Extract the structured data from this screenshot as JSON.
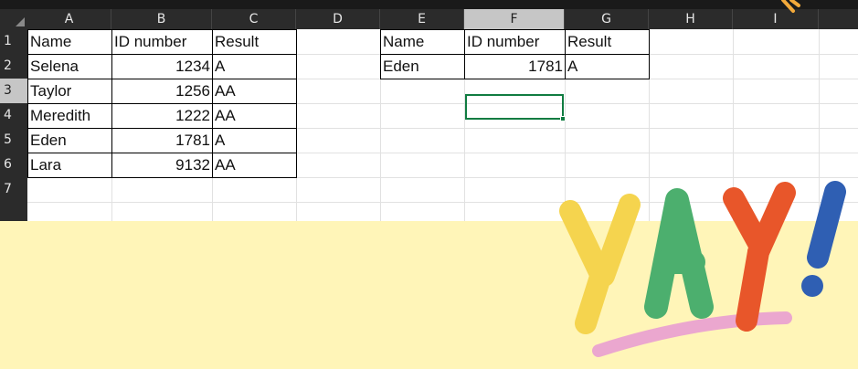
{
  "spreadsheet": {
    "columns": [
      "A",
      "B",
      "C",
      "D",
      "E",
      "F",
      "G",
      "H",
      "I"
    ],
    "active_column": "F",
    "rows": [
      "1",
      "2",
      "3",
      "4",
      "5",
      "6",
      "7"
    ],
    "active_row": "3",
    "table1": {
      "headers": [
        "Name",
        "ID number",
        "Result"
      ],
      "rows": [
        [
          "Selena",
          "1234",
          "A"
        ],
        [
          "Taylor",
          "1256",
          "AA"
        ],
        [
          "Meredith",
          "1222",
          "AA"
        ],
        [
          "Eden",
          "1781",
          "A"
        ],
        [
          "Lara",
          "9132",
          "AA"
        ]
      ]
    },
    "table2": {
      "headers": [
        "Name",
        "ID number",
        "Result"
      ],
      "rows": [
        [
          "Eden",
          "1781",
          "A"
        ]
      ]
    },
    "selected_cell": "F3",
    "selected_cell_value": ""
  },
  "decoration": {
    "text_letters": [
      "Y",
      "A",
      "Y",
      "!"
    ],
    "colors": {
      "background": "#FFF5B8",
      "letter_y1": "#F5D44E",
      "letter_a": "#4CAF6E",
      "letter_y2": "#E8562A",
      "exclaim": "#2F5FB3",
      "underline": "#EBA7CF",
      "selection": "#107C41"
    }
  }
}
